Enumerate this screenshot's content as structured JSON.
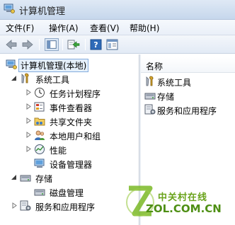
{
  "window": {
    "title": "计算机管理"
  },
  "menubar": {
    "items": [
      {
        "label": "文件(F)"
      },
      {
        "label": "操作(A)"
      },
      {
        "label": "查看(V)"
      },
      {
        "label": "帮助(H)"
      }
    ]
  },
  "toolbar": {
    "buttons": [
      "back-arrow-icon",
      "forward-arrow-icon",
      "show-hide-tree-icon",
      "export-list-icon",
      "help-icon",
      "properties-icon"
    ]
  },
  "tree": {
    "root": {
      "label": "计算机管理(本地)"
    },
    "system_tools": {
      "label": "系统工具"
    },
    "task_scheduler": {
      "label": "任务计划程序"
    },
    "event_viewer": {
      "label": "事件查看器"
    },
    "shared_folders": {
      "label": "共享文件夹"
    },
    "local_users": {
      "label": "本地用户和组"
    },
    "performance": {
      "label": "性能"
    },
    "device_manager": {
      "label": "设备管理器"
    },
    "storage": {
      "label": "存储"
    },
    "disk_management": {
      "label": "磁盘管理"
    },
    "services_apps": {
      "label": "服务和应用程序"
    }
  },
  "list": {
    "column_name": "名称",
    "rows": [
      {
        "label": "系统工具"
      },
      {
        "label": "存储"
      },
      {
        "label": "服务和应用程序"
      }
    ]
  },
  "watermark": {
    "zh": "中关村在线",
    "en": "ZOL.COM.CN"
  }
}
